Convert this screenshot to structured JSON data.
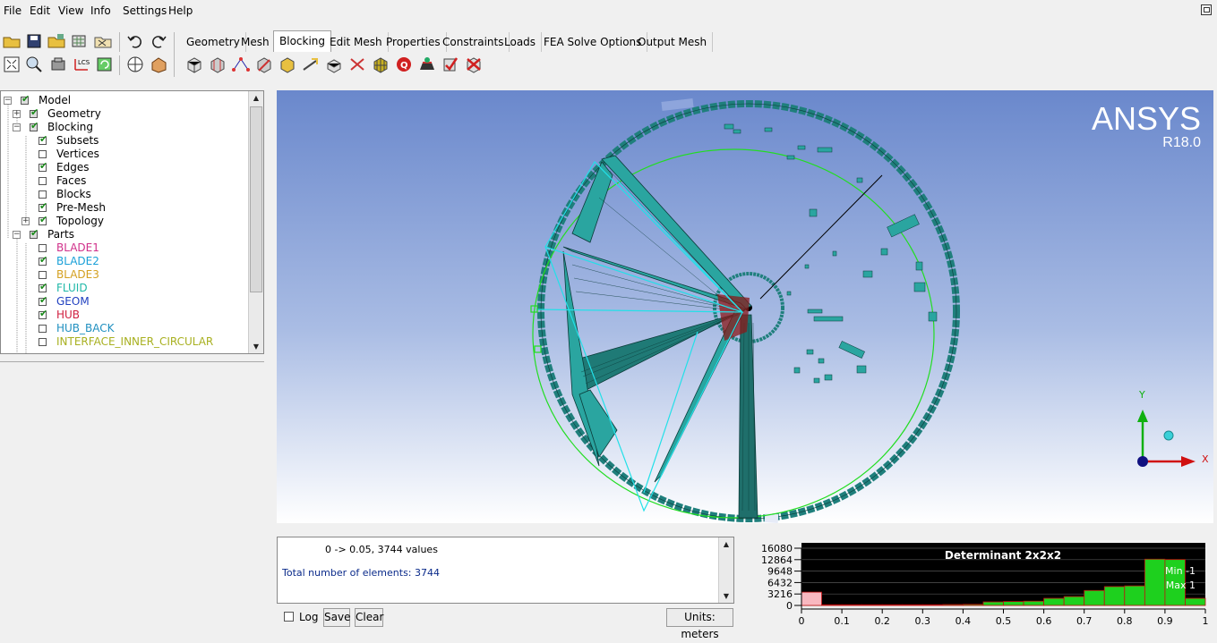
{
  "menu": [
    "File",
    "Edit",
    "View",
    "Info",
    "Settings",
    "Help"
  ],
  "tabs": [
    "Geometry",
    "Mesh",
    "Blocking",
    "Edit Mesh",
    "Properties",
    "Constraints",
    "Loads",
    "FEA Solve Options",
    "Output Mesh"
  ],
  "active_tab": "Blocking",
  "toolbar_icons_row1": [
    "open-icon",
    "save-icon",
    "open-project-icon",
    "save-project-icon",
    "close-project-icon",
    "undo-icon",
    "redo-icon"
  ],
  "toolbar_icons_row2": [
    "fit-window-icon",
    "zoom-icon",
    "measure-icon",
    "lcs-icon",
    "refresh-icon",
    "solid-display-icon",
    "wireframe-display-icon"
  ],
  "blocking_tool_icons": [
    "create-block-icon",
    "split-block-icon",
    "merge-vertices-icon",
    "edit-block-icon",
    "associate-icon",
    "move-vertex-icon",
    "transform-blocks-icon",
    "edit-edge-icon",
    "pre-mesh-params-icon",
    "pre-mesh-quality-icon",
    "pre-mesh-smooth-icon",
    "block-checks-icon",
    "delete-block-icon"
  ],
  "tree": {
    "root": "Model",
    "items": [
      {
        "label": "Geometry",
        "level": 1,
        "checked": "partial",
        "expander": "+",
        "color": "#000000"
      },
      {
        "label": "Blocking",
        "level": 1,
        "checked": "partial",
        "expander": "-",
        "color": "#000000"
      },
      {
        "label": "Subsets",
        "level": 2,
        "checked": true,
        "color": "#000000"
      },
      {
        "label": "Vertices",
        "level": 2,
        "checked": false,
        "color": "#000000"
      },
      {
        "label": "Edges",
        "level": 2,
        "checked": true,
        "color": "#000000"
      },
      {
        "label": "Faces",
        "level": 2,
        "checked": false,
        "color": "#000000"
      },
      {
        "label": "Blocks",
        "level": 2,
        "checked": false,
        "color": "#000000"
      },
      {
        "label": "Pre-Mesh",
        "level": 2,
        "checked": true,
        "color": "#000000"
      },
      {
        "label": "Topology",
        "level": 2,
        "checked": true,
        "expander": "+",
        "color": "#000000"
      },
      {
        "label": "Parts",
        "level": 1,
        "checked": "partial",
        "expander": "-",
        "color": "#000000"
      },
      {
        "label": "BLADE1",
        "level": 2,
        "checked": false,
        "color": "#d0308a"
      },
      {
        "label": "BLADE2",
        "level": 2,
        "checked": true,
        "color": "#1aa0d8"
      },
      {
        "label": "BLADE3",
        "level": 2,
        "checked": false,
        "color": "#d4a020"
      },
      {
        "label": "FLUID",
        "level": 2,
        "checked": true,
        "color": "#20b8a8"
      },
      {
        "label": "GEOM",
        "level": 2,
        "checked": true,
        "color": "#2040c0"
      },
      {
        "label": "HUB",
        "level": 2,
        "checked": true,
        "color": "#d02040"
      },
      {
        "label": "HUB_BACK",
        "level": 2,
        "checked": false,
        "color": "#2090c0"
      },
      {
        "label": "INTERFACE_INNER_CIRCULAR",
        "level": 2,
        "checked": false,
        "color": "#a8b020"
      }
    ]
  },
  "brand": {
    "name": "ANSYS",
    "version": "R18.0"
  },
  "triad": {
    "y": "Y",
    "x": "X"
  },
  "messages": {
    "line1": "0 -> 0.05, 3744 values",
    "line2": "Total number of elements: 3744"
  },
  "bottom": {
    "log": "Log",
    "save": "Save",
    "clear": "Clear",
    "units": "Units: meters"
  },
  "colors": {
    "mesh": "#1f9a96",
    "histogram_bar": "#1ed01e",
    "histogram_bg": "#000000",
    "viewport_top": "#6a88cc"
  },
  "chart_data": {
    "type": "bar",
    "title": "Determinant 2x2x2",
    "annotations": [
      "Min -1",
      "Max 1"
    ],
    "yticks": [
      16080,
      12864,
      9648,
      6432,
      3216,
      0
    ],
    "xticks": [
      "0",
      "0.1",
      "0.2",
      "0.3",
      "0.4",
      "0.5",
      "0.6",
      "0.7",
      "0.8",
      "0.9",
      "1"
    ],
    "xlim": [
      0,
      1
    ],
    "ylim": [
      0,
      16080
    ],
    "bins": [
      {
        "x0": 0.0,
        "x1": 0.05,
        "value": 3744,
        "highlight": true
      },
      {
        "x0": 0.05,
        "x1": 0.1,
        "value": 200
      },
      {
        "x0": 0.1,
        "x1": 0.15,
        "value": 200
      },
      {
        "x0": 0.15,
        "x1": 0.2,
        "value": 200
      },
      {
        "x0": 0.2,
        "x1": 0.25,
        "value": 200
      },
      {
        "x0": 0.25,
        "x1": 0.3,
        "value": 200
      },
      {
        "x0": 0.3,
        "x1": 0.35,
        "value": 200
      },
      {
        "x0": 0.35,
        "x1": 0.4,
        "value": 250
      },
      {
        "x0": 0.4,
        "x1": 0.45,
        "value": 300
      },
      {
        "x0": 0.45,
        "x1": 0.5,
        "value": 1000
      },
      {
        "x0": 0.5,
        "x1": 0.55,
        "value": 1100
      },
      {
        "x0": 0.55,
        "x1": 0.6,
        "value": 1200
      },
      {
        "x0": 0.6,
        "x1": 0.65,
        "value": 2000
      },
      {
        "x0": 0.65,
        "x1": 0.7,
        "value": 2500
      },
      {
        "x0": 0.7,
        "x1": 0.75,
        "value": 4200
      },
      {
        "x0": 0.75,
        "x1": 0.8,
        "value": 5300
      },
      {
        "x0": 0.8,
        "x1": 0.85,
        "value": 5500
      },
      {
        "x0": 0.85,
        "x1": 0.9,
        "value": 13000
      },
      {
        "x0": 0.9,
        "x1": 0.95,
        "value": 12900
      },
      {
        "x0": 0.95,
        "x1": 1.0,
        "value": 2000
      }
    ]
  }
}
